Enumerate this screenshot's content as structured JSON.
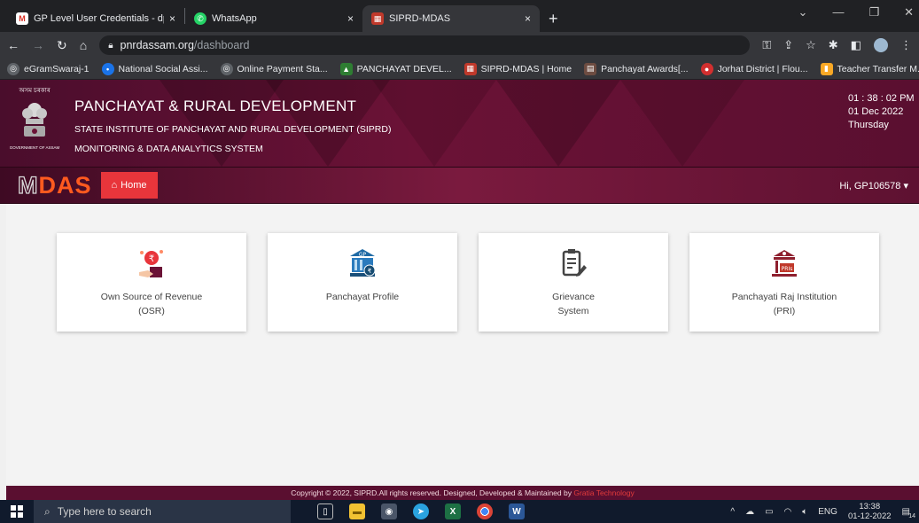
{
  "browser": {
    "tabs": [
      {
        "title": "GP Level User Credentials - dpm",
        "close": "×"
      },
      {
        "title": "WhatsApp",
        "close": "×"
      },
      {
        "title": "SIPRD-MDAS",
        "close": "×"
      }
    ],
    "new_tab": "+",
    "url_host": "pnrdassam.org",
    "url_path": "/dashboard",
    "bookmarks": [
      "eGramSwaraj-1",
      "National Social Assi...",
      "Online Payment Sta...",
      "PANCHAYAT DEVEL...",
      "SIPRD-MDAS | Home",
      "Panchayat Awards[...",
      "Jorhat District | Flou...",
      "Teacher Transfer M..."
    ],
    "bookmarks_more": "»"
  },
  "header": {
    "gov_top": "অসম চৰকাৰ",
    "gov_bottom": "GOVERNMENT OF ASSAM",
    "title": "PANCHAYAT & RURAL DEVELOPMENT",
    "subtitle": "STATE INSTITUTE OF PANCHAYAT AND RURAL DEVELOPMENT (SIPRD)",
    "subtitle2": "MONITORING & DATA ANALYTICS SYSTEM",
    "time": "01 : 38 : 02 PM",
    "date": "01 Dec 2022",
    "day": "Thursday"
  },
  "nav": {
    "logo_m": "M",
    "logo_das": "DAS",
    "home": "Home",
    "greeting": "Hi, GP106578 ▾"
  },
  "cards": [
    {
      "line1": "Own Source of Revenue",
      "line2": "(OSR)"
    },
    {
      "line1": "Panchayat Profile",
      "line2": ""
    },
    {
      "line1": "Grievance",
      "line2": "System"
    },
    {
      "line1": "Panchayati Raj Institution",
      "line2": "(PRI)"
    }
  ],
  "footer": {
    "text": "Copyright © 2022, SIPRD.All rights reserved. Designed, Developed & Maintained by ",
    "brand": "Gratia Technology"
  },
  "taskbar": {
    "search_placeholder": "Type here to search",
    "lang": "ENG",
    "time": "13:38",
    "date": "01-12-2022",
    "notifications": "14"
  },
  "colors": {
    "maroon": "#6b1236",
    "home_red": "#e8353b",
    "logo_orange": "#ff5a1f"
  }
}
